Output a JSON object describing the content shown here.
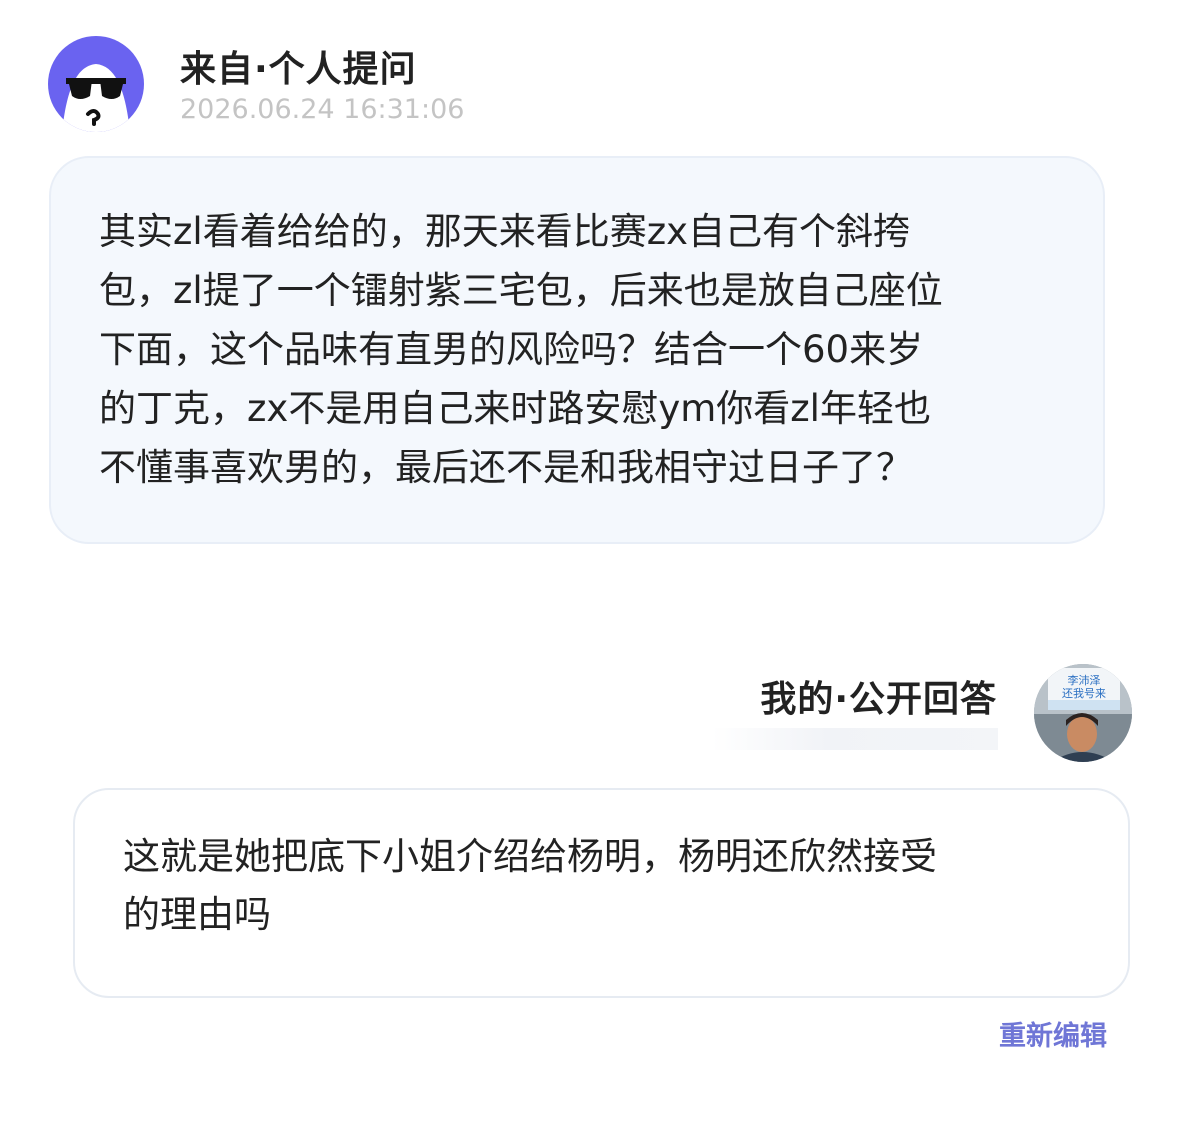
{
  "question": {
    "avatar_icon": "sunglasses-ghost-icon",
    "avatar_color": "#6a63f0",
    "source_label": "来自·个人提问",
    "timestamp": "2026.06.24 16:31:06",
    "body_lines": [
      "其实zl看着给给的，那天来看比赛zx自己有个斜挎",
      "包，zl提了一个镭射紫三宅包，后来也是放自己座位",
      "下面，这个品味有直男的风险吗？结合一个60来岁",
      "的丁克，zx不是用自己来时路安慰ym你看zl年轻也",
      "不懂事喜欢男的，最后还不是和我相守过日子了？"
    ]
  },
  "answer": {
    "label": "我的·公开回答",
    "avatar_sign_lines": [
      "李沛泽",
      "还我号来"
    ],
    "body_lines": [
      "这就是她把底下小姐介绍给杨明，杨明还欣然接受",
      "的理由吗"
    ],
    "reedit_label": "重新编辑",
    "accent_color": "#6f76d6"
  }
}
